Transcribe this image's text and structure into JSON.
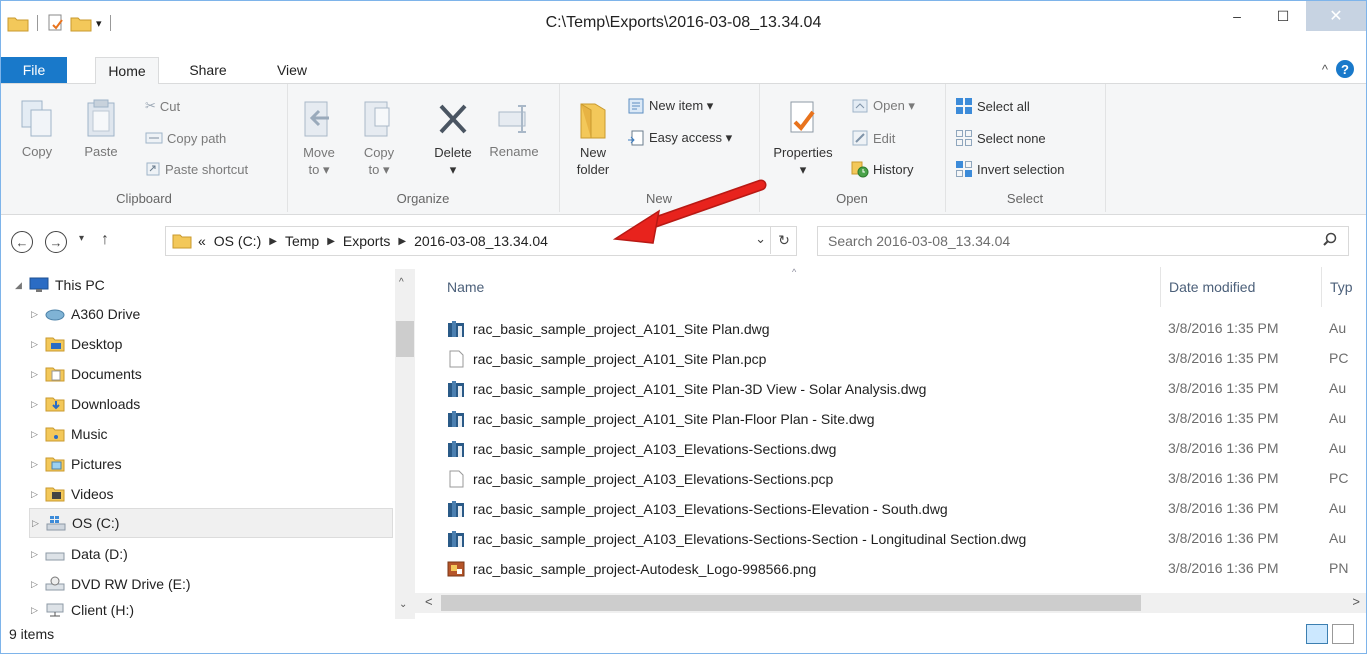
{
  "window": {
    "title": "C:\\Temp\\Exports\\2016-03-08_13.34.04"
  },
  "window_controls": {
    "minimize": "–",
    "maximize": "☐",
    "close": "✕"
  },
  "tabs": [
    {
      "label": "File"
    },
    {
      "label": "Home"
    },
    {
      "label": "Share"
    },
    {
      "label": "View"
    }
  ],
  "ribbon": {
    "clipboard": {
      "label": "Clipboard",
      "copy": "Copy",
      "paste": "Paste",
      "cut": "Cut",
      "copy_path": "Copy path",
      "paste_shortcut": "Paste shortcut"
    },
    "organize": {
      "label": "Organize",
      "move_to": "Move",
      "move_to2": "to ▾",
      "copy_to": "Copy",
      "copy_to2": "to ▾",
      "delete": "Delete",
      "delete2": "▾",
      "rename": "Rename"
    },
    "new": {
      "label": "New",
      "new_folder": "New",
      "new_folder2": "folder",
      "new_item": "New item ▾",
      "easy_access": "Easy access ▾"
    },
    "open": {
      "label": "Open",
      "properties": "Properties",
      "properties2": "▾",
      "open": "Open ▾",
      "edit": "Edit",
      "history": "History"
    },
    "select": {
      "label": "Select",
      "select_all": "Select all",
      "select_none": "Select none",
      "invert": "Invert selection"
    }
  },
  "address": {
    "chevron": "«",
    "crumbs": [
      "OS (C:)",
      "Temp",
      "Exports",
      "2016-03-08_13.34.04"
    ],
    "dropdown": "⌄",
    "refresh": "↻"
  },
  "search": {
    "placeholder": "Search 2016-03-08_13.34.04"
  },
  "nav_tree": [
    {
      "label": "This PC",
      "icon": "computer-icon",
      "expanded": true
    },
    {
      "label": "A360 Drive",
      "icon": "cloud-drive-icon"
    },
    {
      "label": "Desktop",
      "icon": "desktop-folder-icon"
    },
    {
      "label": "Documents",
      "icon": "documents-folder-icon"
    },
    {
      "label": "Downloads",
      "icon": "downloads-folder-icon"
    },
    {
      "label": "Music",
      "icon": "music-folder-icon"
    },
    {
      "label": "Pictures",
      "icon": "pictures-folder-icon"
    },
    {
      "label": "Videos",
      "icon": "videos-folder-icon"
    },
    {
      "label": "OS (C:)",
      "icon": "windows-drive-icon",
      "selected": true
    },
    {
      "label": "Data (D:)",
      "icon": "drive-icon"
    },
    {
      "label": "DVD RW Drive (E:)",
      "icon": "dvd-drive-icon"
    },
    {
      "label": "Client (H:)",
      "icon": "network-drive-icon"
    }
  ],
  "columns": {
    "name": "Name",
    "date": "Date modified",
    "type": "Typ"
  },
  "files": [
    {
      "name": "rac_basic_sample_project_A101_Site Plan.dwg",
      "date": "3/8/2016 1:35 PM",
      "type": "Au",
      "icon": "dwg-file-icon"
    },
    {
      "name": "rac_basic_sample_project_A101_Site Plan.pcp",
      "date": "3/8/2016 1:35 PM",
      "type": "PC",
      "icon": "blank-file-icon"
    },
    {
      "name": "rac_basic_sample_project_A101_Site Plan-3D View - Solar Analysis.dwg",
      "date": "3/8/2016 1:35 PM",
      "type": "Au",
      "icon": "dwg-file-icon"
    },
    {
      "name": "rac_basic_sample_project_A101_Site Plan-Floor Plan - Site.dwg",
      "date": "3/8/2016 1:35 PM",
      "type": "Au",
      "icon": "dwg-file-icon"
    },
    {
      "name": "rac_basic_sample_project_A103_Elevations-Sections.dwg",
      "date": "3/8/2016 1:36 PM",
      "type": "Au",
      "icon": "dwg-file-icon"
    },
    {
      "name": "rac_basic_sample_project_A103_Elevations-Sections.pcp",
      "date": "3/8/2016 1:36 PM",
      "type": "PC",
      "icon": "blank-file-icon"
    },
    {
      "name": "rac_basic_sample_project_A103_Elevations-Sections-Elevation - South.dwg",
      "date": "3/8/2016 1:36 PM",
      "type": "Au",
      "icon": "dwg-file-icon"
    },
    {
      "name": "rac_basic_sample_project_A103_Elevations-Sections-Section - Longitudinal Section.dwg",
      "date": "3/8/2016 1:36 PM",
      "type": "Au",
      "icon": "dwg-file-icon"
    },
    {
      "name": "rac_basic_sample_project-Autodesk_Logo-998566.png",
      "date": "3/8/2016 1:36 PM",
      "type": "PN",
      "icon": "png-file-icon"
    }
  ],
  "status": {
    "items": "9 items"
  },
  "colors": {
    "file_tab": "#1979ca",
    "annotation_arrow": "#e8231d",
    "folder": "#f3c85a"
  }
}
